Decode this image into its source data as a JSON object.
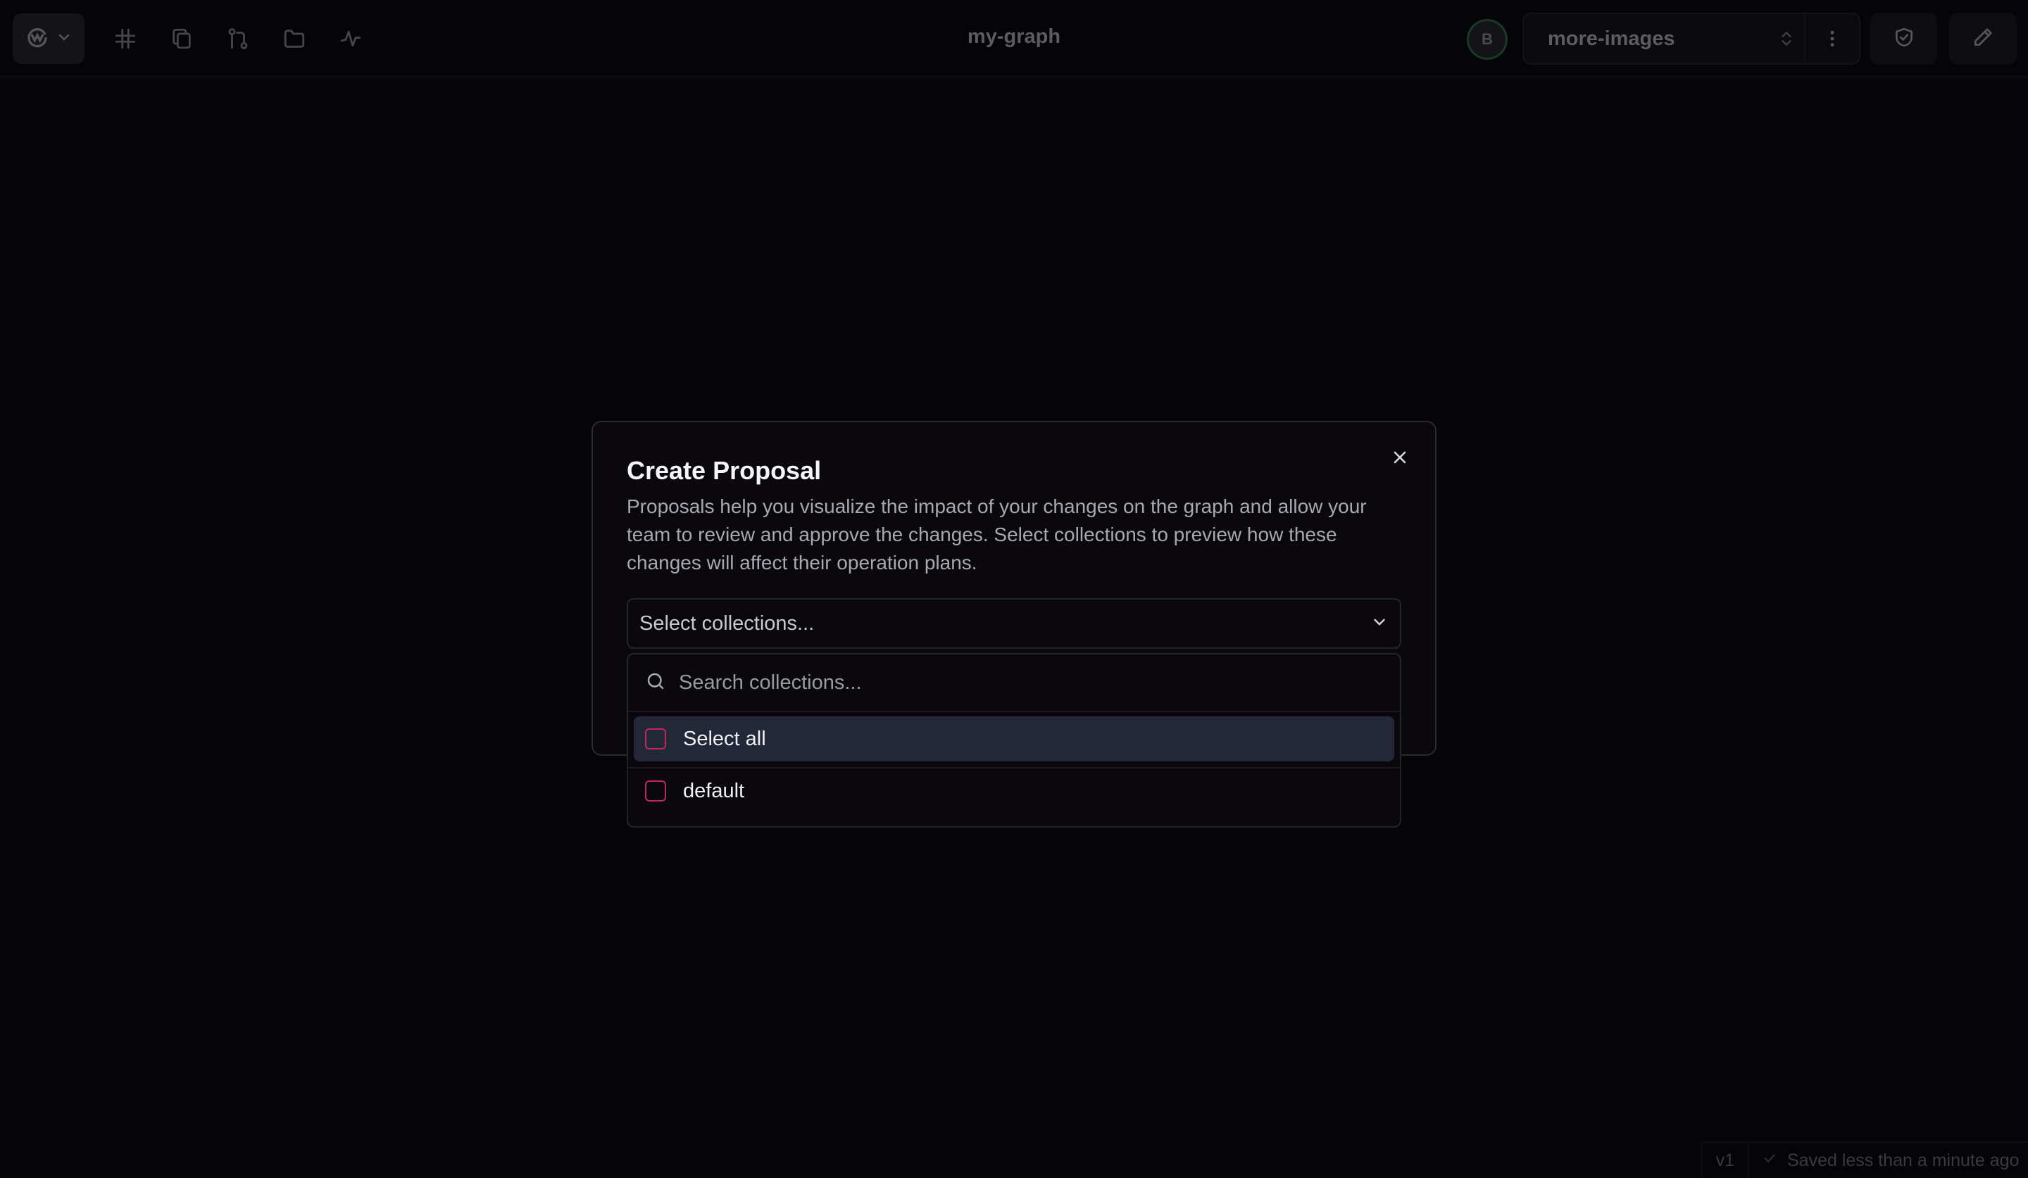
{
  "header": {
    "graph_title": "my-graph",
    "avatar_initial": "B",
    "branch": "more-images"
  },
  "toolbar": {
    "icons": [
      "logo-icon",
      "grid-icon",
      "copy-icon",
      "git-compare-icon",
      "folder-icon",
      "activity-icon"
    ]
  },
  "status": {
    "version": "v1",
    "saved_text": "Saved less than a minute ago"
  },
  "modal": {
    "title": "Create Proposal",
    "description": "Proposals help you visualize the impact of your changes on the graph and allow your team to review and approve the changes. Select collections to preview how these changes will affect their operation plans.",
    "select_placeholder": "Select collections..."
  },
  "dropdown": {
    "search_placeholder": "Search collections...",
    "select_all_label": "Select all",
    "options": [
      {
        "label": "default",
        "checked": false
      }
    ]
  },
  "colors": {
    "accent_checkbox": "#c2275f",
    "highlight_row": "#222837",
    "avatar_ring": "#1a3a22"
  }
}
